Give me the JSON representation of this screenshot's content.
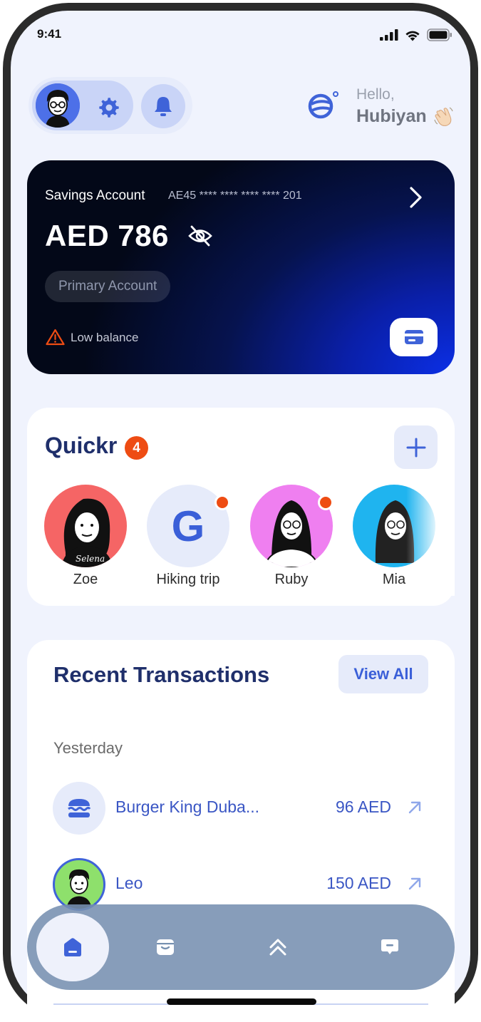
{
  "status_bar": {
    "time": "9:41"
  },
  "header": {
    "greeting": "Hello,",
    "user_name": "Hubiyan"
  },
  "account_card": {
    "account_type": "Savings Account",
    "iban_masked": "AE45 **** **** **** **** 201",
    "balance": "AED 786",
    "badge": "Primary Account",
    "warning": "Low balance"
  },
  "quickr": {
    "title": "Quickr",
    "count": "4",
    "contacts": [
      {
        "name": "Zoe",
        "initial": "",
        "unread": false
      },
      {
        "name": "Hiking trip",
        "initial": "G",
        "unread": true
      },
      {
        "name": "Ruby",
        "initial": "",
        "unread": true
      },
      {
        "name": "Mia",
        "initial": "",
        "unread": false
      }
    ]
  },
  "transactions": {
    "title": "Recent Transactions",
    "view_all_label": "View All",
    "section_label": "Yesterday",
    "items": [
      {
        "name": "Burger King Duba...",
        "amount": "96 AED",
        "icon": "burger-icon"
      },
      {
        "name": "Leo",
        "amount": "150 AED",
        "icon": "avatar"
      }
    ]
  },
  "bottom_nav": {
    "items": [
      "home-icon",
      "inbox-icon",
      "chevrons-up-icon",
      "message-icon"
    ],
    "active": "home-icon"
  },
  "colors": {
    "accent": "#3a5fd8",
    "title": "#1f2f6b",
    "badge": "#ee4c13",
    "screen_bg": "#f0f3fd"
  }
}
